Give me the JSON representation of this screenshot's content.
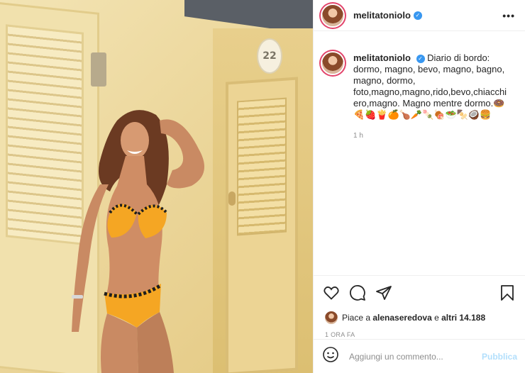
{
  "photo": {
    "door_number": "22",
    "colors": {
      "wall": "#ecd79c",
      "door": "#ecd494",
      "swimsuit": "#f5a623",
      "trim": "#1e1e1e"
    }
  },
  "header": {
    "username": "melitatoniolo",
    "verified": true,
    "more_icon": "ellipsis-icon",
    "more_label": "•••"
  },
  "caption": {
    "username": "melitatoniolo",
    "text": "Diario di bordo: dormo, magno, bevo, magno, bagno, magno, dormo, foto,magno,magno,rido,bevo,chiacchiero,magno. Magno mentre dormo.🍩🍕🍓🍟🍊🍗🥕🍡🍖🥗🍢🥥🍔",
    "time": "1 h"
  },
  "actions": {
    "icons": [
      "heart-icon",
      "comment-icon",
      "share-icon",
      "bookmark-icon"
    ]
  },
  "likes": {
    "prefix": "Piace a ",
    "user": "alenaseredova",
    "middle": " e ",
    "count": "altri 14.188"
  },
  "post_time": "1 ORA FA",
  "comment": {
    "placeholder": "Aggiungi un commento...",
    "publish_label": "Pubblica",
    "emoji_icon": "smiley-icon"
  },
  "accent_colors": {
    "link": "#3897f0",
    "publish_disabled": "#b2dffc",
    "story_ring": "#e2446b"
  }
}
